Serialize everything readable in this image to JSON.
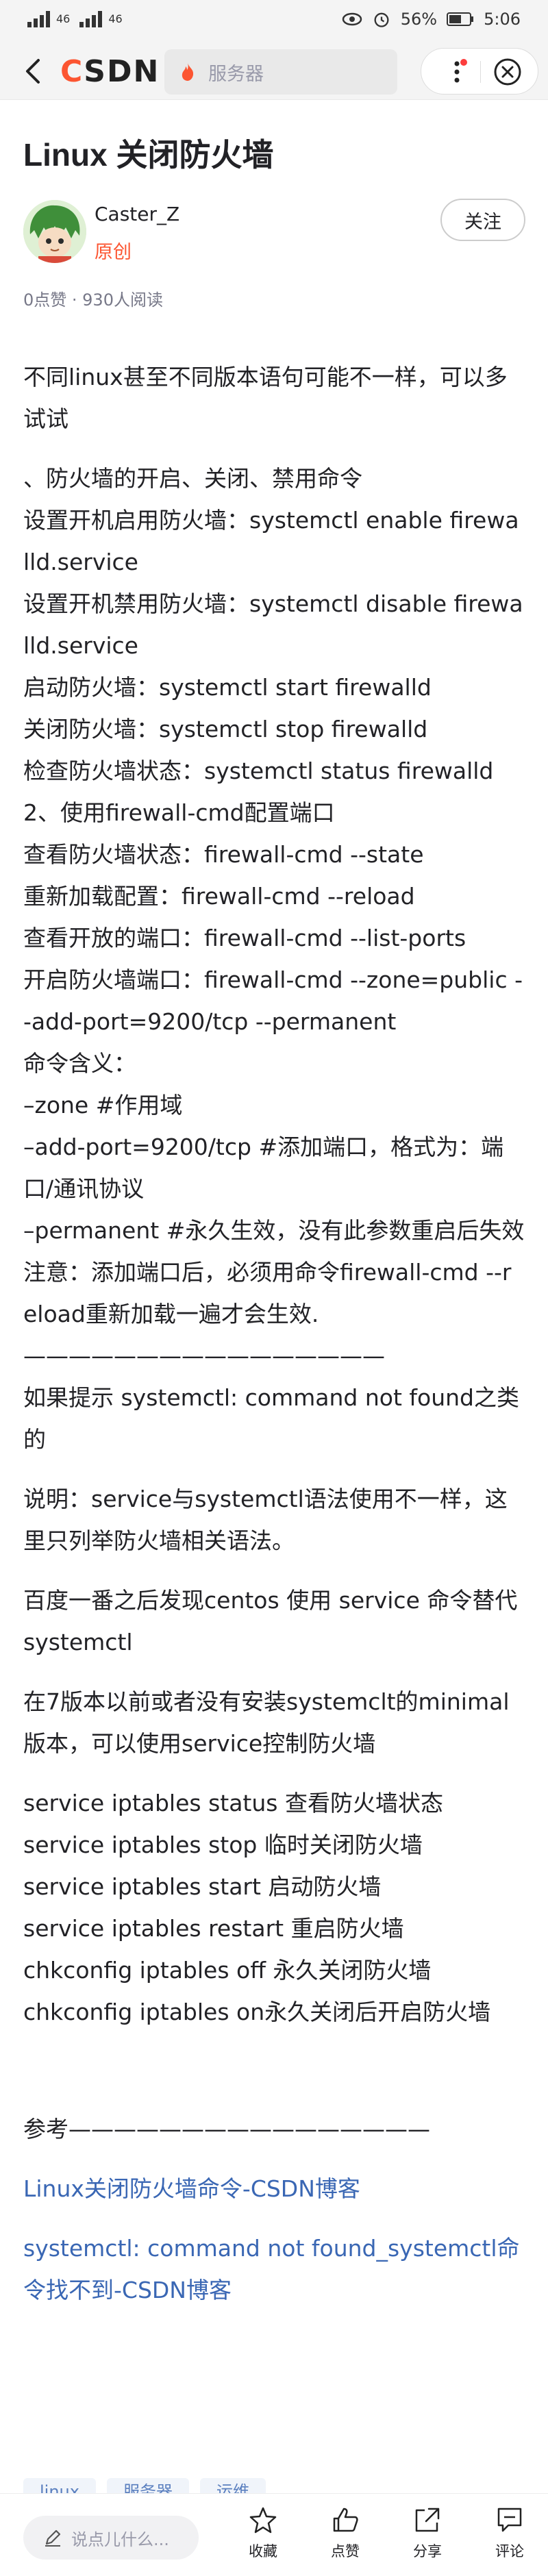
{
  "statusbar": {
    "left_signal_1": "46",
    "left_signal_2": "46",
    "battery": "56%",
    "time": "5:06"
  },
  "topbar": {
    "logo": "CSDN",
    "search_placeholder": "服务器",
    "accent_color": "#fc5531"
  },
  "article": {
    "title": "Linux 关闭防火墙",
    "author": "Caster_Z",
    "badge": "原创",
    "follow_label": "关注",
    "stats": "0点赞 · 930人阅读"
  },
  "content": {
    "intro": "不同linux甚至不同版本语句可能不一样，可以多试试",
    "block1": [
      "、防火墙的开启、关闭、禁用命令",
      "设置开机启用防火墙：systemctl enable firewalld.service",
      "设置开机禁用防火墙：systemctl disable firewalld.service",
      "启动防火墙：systemctl start firewalld",
      "关闭防火墙：systemctl stop firewalld",
      "检查防火墙状态：systemctl status firewalld",
      "2、使用firewall-cmd配置端口",
      "查看防火墙状态：firewall-cmd --state",
      "重新加载配置：firewall-cmd --reload",
      "查看开放的端口：firewall-cmd --list-ports",
      "开启防火墙端口：firewall-cmd --zone=public --add-port=9200/tcp --permanent",
      "命令含义：",
      "–zone #作用域",
      "–add-port=9200/tcp #添加端口，格式为：端口/通讯协议",
      "–permanent #永久生效，没有此参数重启后失效",
      "注意：添加端口后，必须用命令firewall-cmd --reload重新加载一遍才会生效.",
      "————————————————"
    ],
    "p_not_found": "如果提示 systemctl: command not found之类的",
    "p_explain": "说明：service与systemctl语法使用不一样，这里只列举防火墙相关语法。",
    "p_baidu": "百度一番之后发现centos 使用 service 命令替代systemctl",
    "p_version": "在7版本以前或者没有安装systemclt的minimal版本，可以使用service控制防火墙",
    "service_lines": [
      "service iptables status 查看防火墙状态",
      "service iptables stop 临时关闭防火墙",
      "service iptables start 启动防火墙",
      "service iptables restart 重启防火墙",
      "chkconfig iptables off 永久关闭防火墙",
      "chkconfig iptables on永久关闭后开启防火墙"
    ],
    "reference": "参考————————————————",
    "links": [
      "Linux关闭防火墙命令-CSDN博客",
      "systemctl: command not found_systemctl命令找不到-CSDN博客"
    ]
  },
  "tags": [
    "linux",
    "服务器",
    "运维"
  ],
  "bottombar": {
    "comment_placeholder": "说点儿什么...",
    "actions": [
      "收藏",
      "点赞",
      "分享",
      "评论"
    ]
  }
}
